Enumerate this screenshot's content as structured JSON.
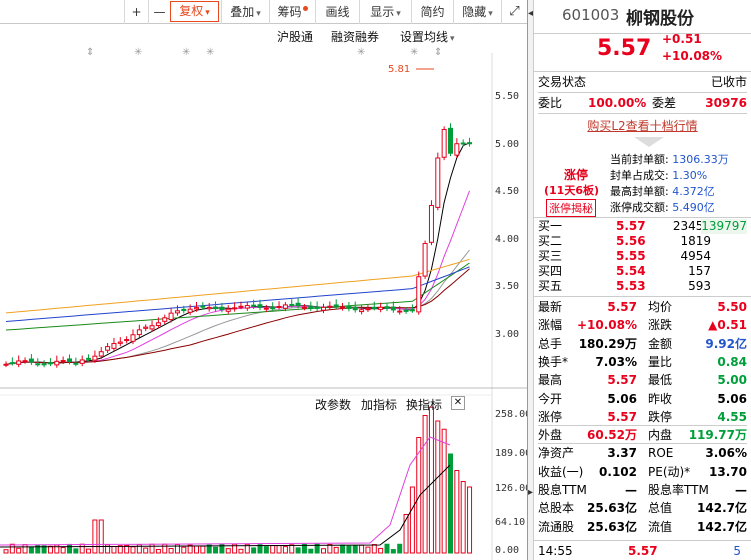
{
  "toolbar": {
    "plus": "+",
    "minus": "—",
    "adjust": "复权",
    "overlay": "叠加",
    "chips": "筹码",
    "draw": "画线",
    "display": "显示",
    "simple": "简约",
    "hide": "隐藏"
  },
  "indicator_links": {
    "hgt": "沪股通",
    "margin": "融资融券",
    "ma_setting": "设置均线"
  },
  "price_axis": [
    "5.50",
    "5.00",
    "4.50",
    "4.00",
    "3.50",
    "3.00"
  ],
  "peak_label": "5.81",
  "volume_toolbar": {
    "change_params": "改参数",
    "add_indicator": "加指标",
    "switch_indicator": "换指标"
  },
  "volume_axis": [
    "258.00",
    "189.00",
    "126.00",
    "64.10",
    "0.00"
  ],
  "stock": {
    "code": "601003",
    "name": "柳钢股份",
    "price": "5.57",
    "change": "+0.51",
    "pct": "+10.08%"
  },
  "status": {
    "label": "交易状态",
    "value": "已收市"
  },
  "commission": {
    "label1": "委比",
    "value1": "100.00%",
    "label2": "委差",
    "value2": "30976"
  },
  "l2_link": "购买L2查看十档行情",
  "limit_up": {
    "badge": "涨停",
    "streak": "(11天6板)",
    "reveal": "涨停揭秘",
    "rows": [
      {
        "label": "当前封单额:",
        "value": "1306.33万"
      },
      {
        "label": "封单占成交:",
        "value": "1.30%"
      },
      {
        "label": "最高封单额:",
        "value": "4.372亿"
      },
      {
        "label": "涨停成交额:",
        "value": "5.490亿"
      }
    ]
  },
  "bids": [
    {
      "label": "买一",
      "price": "5.57",
      "vol": "23453",
      "extra": "139797"
    },
    {
      "label": "买二",
      "price": "5.56",
      "vol": "1819",
      "extra": ""
    },
    {
      "label": "买三",
      "price": "5.55",
      "vol": "4954",
      "extra": ""
    },
    {
      "label": "买四",
      "price": "5.54",
      "vol": "157",
      "extra": ""
    },
    {
      "label": "买五",
      "price": "5.53",
      "vol": "593",
      "extra": ""
    }
  ],
  "stats": [
    {
      "l1": "最新",
      "v1": "5.57",
      "c1": "red",
      "l2": "均价",
      "v2": "5.50",
      "c2": "red"
    },
    {
      "l1": "涨幅",
      "v1": "+10.08%",
      "c1": "red",
      "l2": "涨跌",
      "v2": "▲0.51",
      "c2": "red"
    },
    {
      "l1": "总手",
      "v1": "180.29万",
      "c1": "",
      "l2": "金额",
      "v2": "9.92亿",
      "c2": "blue"
    },
    {
      "l1": "换手*",
      "v1": "7.03%",
      "c1": "",
      "l2": "量比",
      "v2": "0.84",
      "c2": "green"
    },
    {
      "l1": "最高",
      "v1": "5.57",
      "c1": "red",
      "l2": "最低",
      "v2": "5.00",
      "c2": "green"
    },
    {
      "l1": "今开",
      "v1": "5.06",
      "c1": "",
      "l2": "昨收",
      "v2": "5.06",
      "c2": ""
    },
    {
      "l1": "涨停",
      "v1": "5.57",
      "c1": "red",
      "l2": "跌停",
      "v2": "4.55",
      "c2": "green"
    },
    {
      "l1": "外盘",
      "v1": "60.52万",
      "c1": "red",
      "l2": "内盘",
      "v2": "119.77万",
      "c2": "green"
    },
    {
      "l1": "净资产",
      "v1": "3.37",
      "c1": "",
      "l2": "ROE",
      "v2": "3.06%",
      "c2": ""
    },
    {
      "l1": "收益(一)",
      "v1": "0.102",
      "c1": "",
      "l2": "PE(动)*",
      "v2": "13.70",
      "c2": ""
    },
    {
      "l1": "股息TTM",
      "v1": "—",
      "c1": "",
      "l2": "股息率TTM",
      "v2": "—",
      "c2": ""
    },
    {
      "l1": "总股本",
      "v1": "25.63亿",
      "c1": "",
      "l2": "总值",
      "v2": "142.7亿",
      "c2": ""
    },
    {
      "l1": "流通股",
      "v1": "25.63亿",
      "c1": "",
      "l2": "流值",
      "v2": "142.7亿",
      "c2": ""
    }
  ],
  "last_trade": {
    "time": "14:55",
    "price": "5.57",
    "vol": "5"
  },
  "colors": {
    "up": "#e8001c",
    "down": "#009e3a",
    "accent": "#e8491d"
  }
}
